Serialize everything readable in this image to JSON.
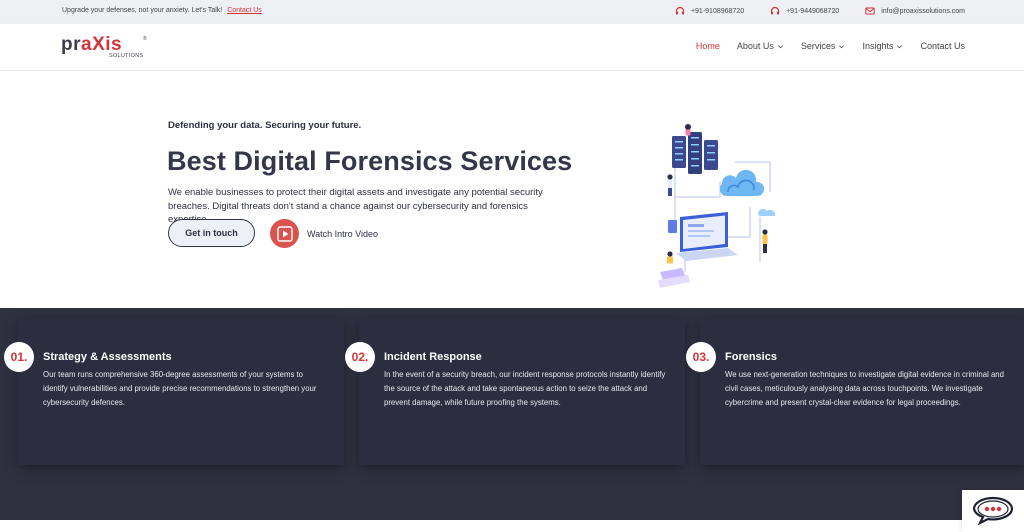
{
  "topbar": {
    "message": "Upgrade your defenses, not your anxiety. Let's Talk!",
    "contact_link": "Contact Us",
    "phone1": "+91-9108968720",
    "phone2": "+91-9449068720",
    "email": "info@proaxissolutions.com"
  },
  "logo": {
    "word_a": "pr",
    "word_b": "aXis",
    "sub": "SOLUTIONS",
    "reg": "®"
  },
  "nav": {
    "home": "Home",
    "about": "About Us",
    "services": "Services",
    "insights": "Insights",
    "contact": "Contact Us"
  },
  "hero": {
    "tagline": "Defending your data. Securing your future.",
    "title": "Best Digital Forensics Services",
    "description": "We enable businesses to protect their digital assets and investigate any potential security breaches. Digital threats don't stand a chance against our cybersecurity and forensics expertise.",
    "cta": "Get in touch",
    "video_label": "Watch Intro Video"
  },
  "services": [
    {
      "num": "01.",
      "title": "Strategy & Assessments",
      "text": "Our team runs comprehensive 360-degree assessments of your systems to identify vulnerabilities and provide precise recommendations to strengthen your cybersecurity defences."
    },
    {
      "num": "02.",
      "title": "Incident Response",
      "text": "In the event of a security breach, our incident response protocols instantly identify the source of the attack and take spontaneous action to seize the attack and prevent damage, while future proofing the systems."
    },
    {
      "num": "03.",
      "title": "Forensics",
      "text": "We use next-generation techniques to investigate digital evidence in criminal and civil cases, meticulously analysing data across touchpoints. We investigate cybercrime and present crystal-clear evidence for legal proceedings."
    }
  ],
  "colors": {
    "accent": "#d3343a",
    "dark_band": "#2f3141",
    "heading": "#34374a"
  }
}
